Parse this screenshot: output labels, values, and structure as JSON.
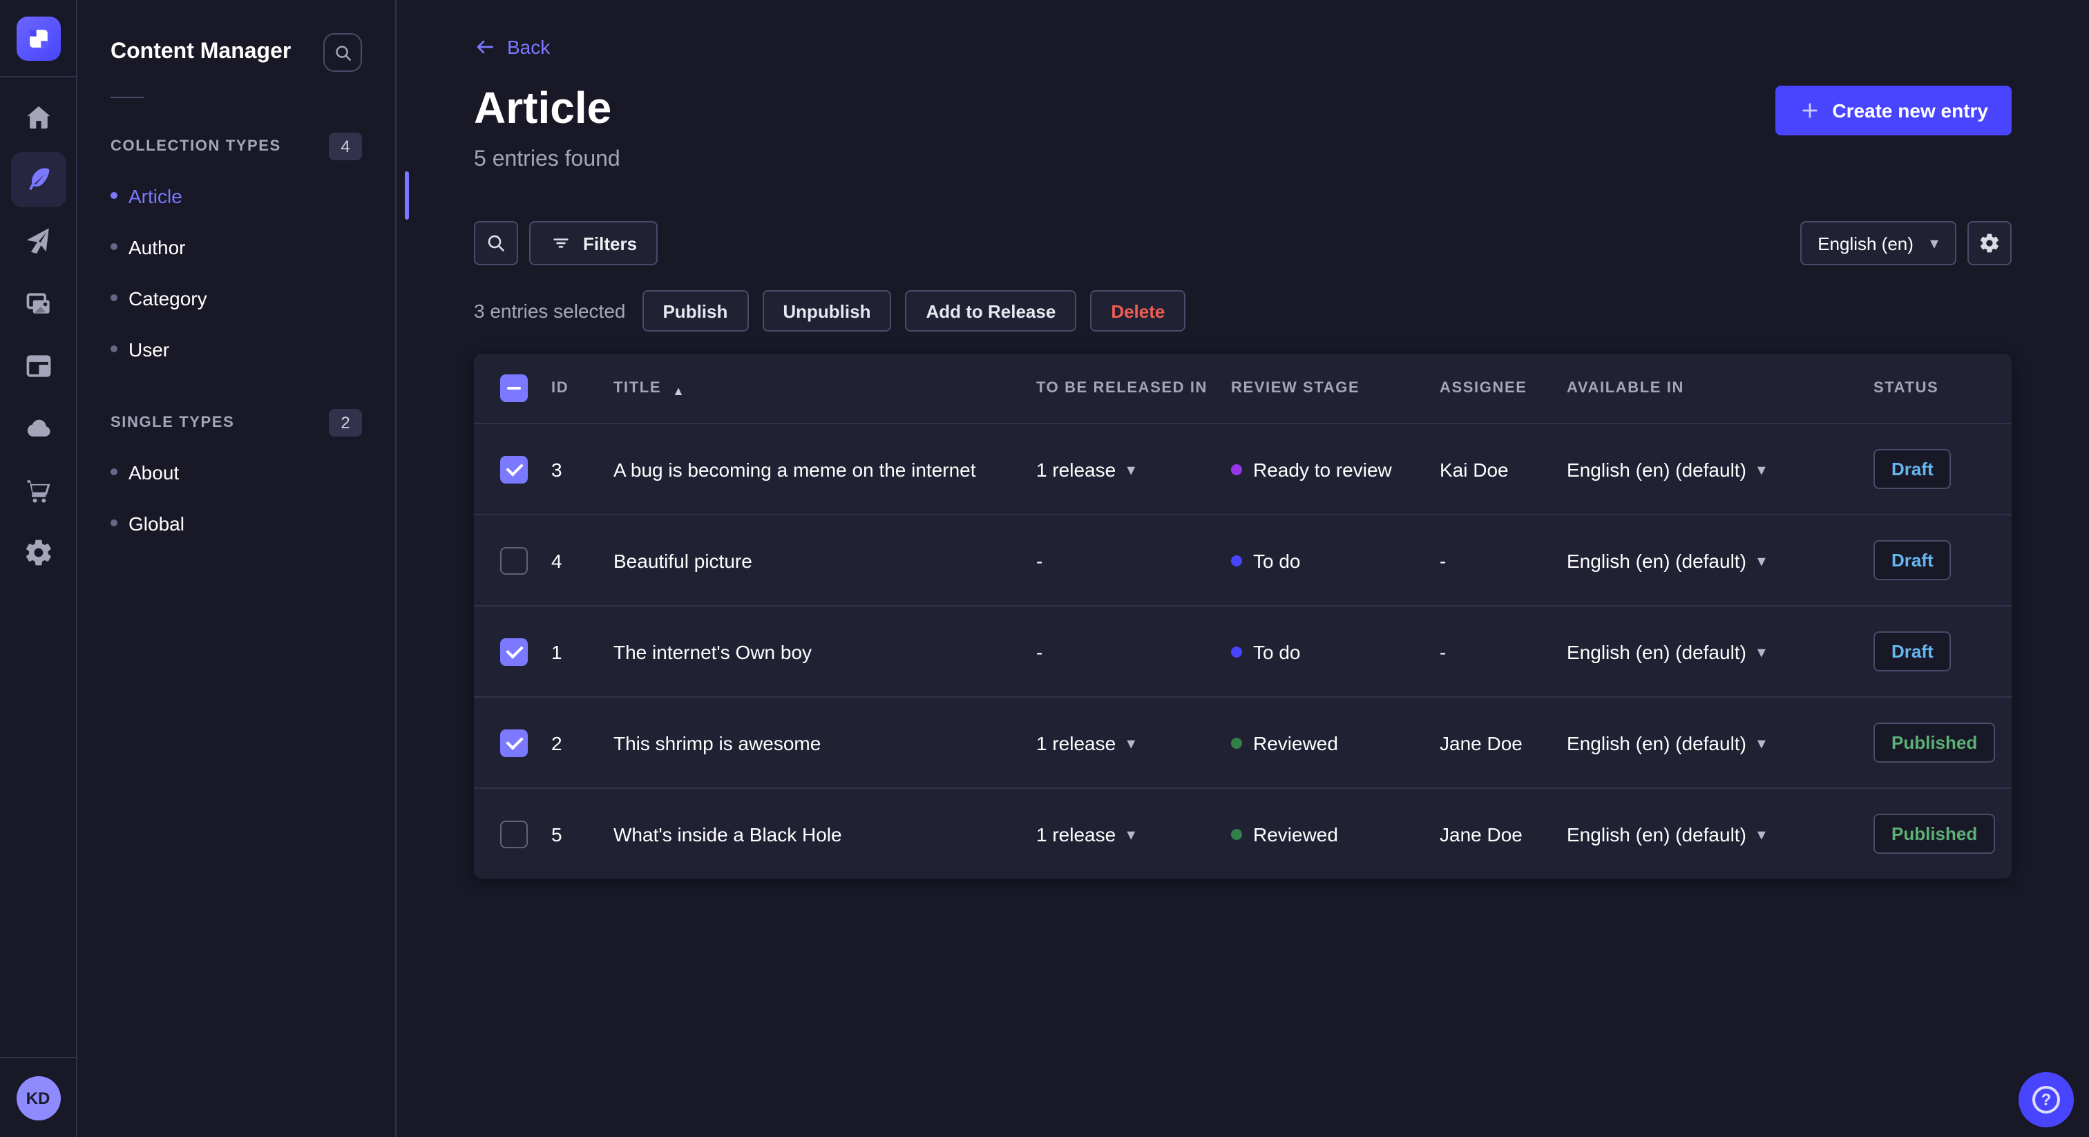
{
  "colors": {
    "accent": "#4945ff",
    "primary_light": "#7b79ff",
    "draft_text": "#66b7f1",
    "published_text": "#5cb176",
    "danger_text": "#ee5e52",
    "dot_ready_to_review": "#9736e8",
    "dot_to_do": "#4945ff",
    "dot_reviewed": "#328048"
  },
  "nav": {
    "items": [
      {
        "icon": "home",
        "active": false
      },
      {
        "icon": "feather-content-manager",
        "active": true
      },
      {
        "icon": "paper-plane",
        "active": false
      },
      {
        "icon": "media-library",
        "active": false
      },
      {
        "icon": "layout-builder",
        "active": false
      },
      {
        "icon": "cloud",
        "active": false
      },
      {
        "icon": "cart-marketplace",
        "active": false
      },
      {
        "icon": "gear-settings",
        "active": false
      }
    ]
  },
  "user": {
    "initials": "KD"
  },
  "sidebar": {
    "title": "Content Manager",
    "sections": [
      {
        "label": "COLLECTION TYPES",
        "count": "4",
        "items": [
          {
            "label": "Article",
            "active": true
          },
          {
            "label": "Author",
            "active": false
          },
          {
            "label": "Category",
            "active": false
          },
          {
            "label": "User",
            "active": false
          }
        ]
      },
      {
        "label": "SINGLE TYPES",
        "count": "2",
        "items": [
          {
            "label": "About",
            "active": false
          },
          {
            "label": "Global",
            "active": false
          }
        ]
      }
    ]
  },
  "header": {
    "back_label": "Back",
    "title": "Article",
    "subtitle": "5 entries found",
    "create_button": "Create new entry"
  },
  "toolbar": {
    "filters_label": "Filters",
    "locale_value": "English (en)"
  },
  "selection": {
    "text": "3 entries selected",
    "actions": [
      "Publish",
      "Unpublish",
      "Add to Release",
      "Delete"
    ]
  },
  "table": {
    "columns": [
      "ID",
      "TITLE",
      "TO BE RELEASED IN",
      "REVIEW STAGE",
      "ASSIGNEE",
      "AVAILABLE IN",
      "STATUS"
    ],
    "sort_column": "TITLE",
    "sort_direction": "asc",
    "rows": [
      {
        "checked": true,
        "id": "3",
        "title": "A bug is becoming a meme on the internet",
        "released_in": "1 release",
        "released_caret": true,
        "review_stage": "Ready to review",
        "review_color": "#9736e8",
        "assignee": "Kai Doe",
        "available_in": "English (en) (default)",
        "status": "Draft"
      },
      {
        "checked": false,
        "id": "4",
        "title": "Beautiful picture",
        "released_in": "-",
        "released_caret": false,
        "review_stage": "To do",
        "review_color": "#4945ff",
        "assignee": "-",
        "available_in": "English (en) (default)",
        "status": "Draft"
      },
      {
        "checked": true,
        "id": "1",
        "title": "The internet's Own boy",
        "released_in": "-",
        "released_caret": false,
        "review_stage": "To do",
        "review_color": "#4945ff",
        "assignee": "-",
        "available_in": "English (en) (default)",
        "status": "Draft"
      },
      {
        "checked": true,
        "id": "2",
        "title": "This shrimp is awesome",
        "released_in": "1 release",
        "released_caret": true,
        "review_stage": "Reviewed",
        "review_color": "#328048",
        "assignee": "Jane Doe",
        "available_in": "English (en) (default)",
        "status": "Published"
      },
      {
        "checked": false,
        "id": "5",
        "title": "What's inside a Black Hole",
        "released_in": "1 release",
        "released_caret": true,
        "review_stage": "Reviewed",
        "review_color": "#328048",
        "assignee": "Jane Doe",
        "available_in": "English (en) (default)",
        "status": "Published"
      }
    ]
  }
}
